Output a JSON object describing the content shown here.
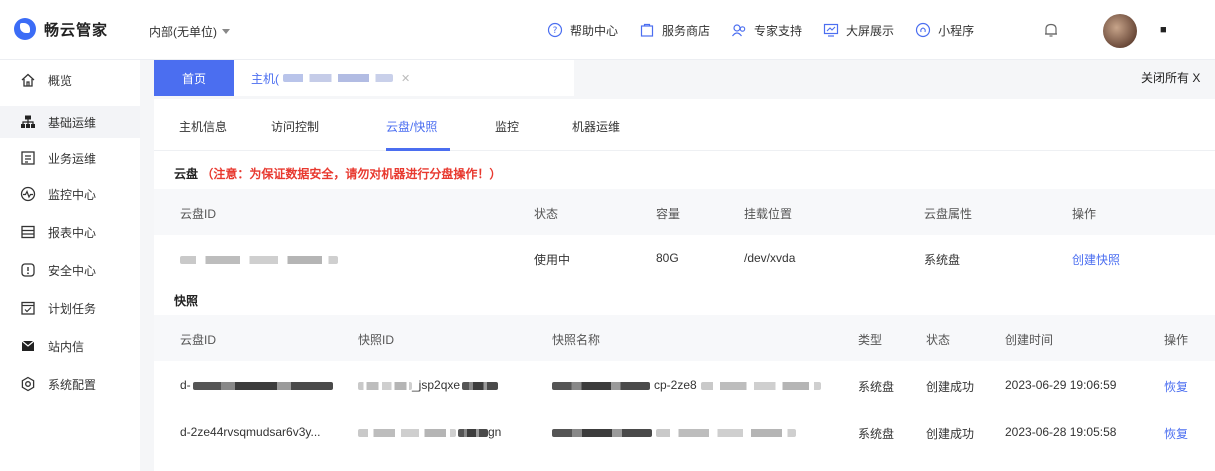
{
  "app": {
    "name": "畅云管家"
  },
  "unit_selector": {
    "value": "内部(无单位)"
  },
  "top_nav": {
    "links": [
      {
        "label": "帮助中心",
        "icon": "help-icon"
      },
      {
        "label": "服务商店",
        "icon": "store-icon"
      },
      {
        "label": "专家支持",
        "icon": "support-icon"
      },
      {
        "label": "大屏展示",
        "icon": "screen-icon"
      },
      {
        "label": "小程序",
        "icon": "miniapp-icon"
      }
    ],
    "user_name": "■"
  },
  "sidebar": {
    "items": [
      {
        "label": "概览",
        "icon": "home-icon"
      },
      {
        "label": "基础运维",
        "icon": "ops-icon"
      },
      {
        "label": "业务运维",
        "icon": "business-icon"
      },
      {
        "label": "监控中心",
        "icon": "monitor-icon"
      },
      {
        "label": "报表中心",
        "icon": "report-icon"
      },
      {
        "label": "安全中心",
        "icon": "security-icon"
      },
      {
        "label": "计划任务",
        "icon": "task-icon"
      },
      {
        "label": "站内信",
        "icon": "mail-icon"
      },
      {
        "label": "系统配置",
        "icon": "settings-icon"
      }
    ]
  },
  "page_tabs": {
    "home": "首页",
    "host": "主机(",
    "close_all": "关闭所有 X"
  },
  "subtabs": [
    "主机信息",
    "访问控制",
    "云盘/快照",
    "监控",
    "机器运维"
  ],
  "disk_section": {
    "title": "云盘",
    "warning": "（注意：为保证数据安全，请勿对机器进行分盘操作！）",
    "columns": [
      "云盘ID",
      "状态",
      "容量",
      "挂载位置",
      "云盘属性",
      "操作"
    ],
    "row": {
      "status": "使用中",
      "capacity": "80G",
      "mount": "/dev/xvda",
      "attr": "系统盘",
      "action": "创建快照"
    }
  },
  "snapshot_section": {
    "title": "快照",
    "columns": [
      "云盘ID",
      "快照ID",
      "快照名称",
      "类型",
      "状态",
      "创建时间",
      "操作"
    ],
    "rows": [
      {
        "disk_id": "d-",
        "snap_id_tail": "_jsp2qxe",
        "name_mid": "cp-2ze8",
        "type": "系统盘",
        "status": "创建成功",
        "time": "2023-06-29 19:06:59",
        "action": "恢复"
      },
      {
        "disk_id": "d-2ze44rvsqmudsar6v3y...",
        "snap_id_tail": "gn",
        "name_mid": "",
        "type": "系统盘",
        "status": "创建成功",
        "time": "2023-06-28 19:05:58",
        "action": "恢复"
      }
    ]
  }
}
